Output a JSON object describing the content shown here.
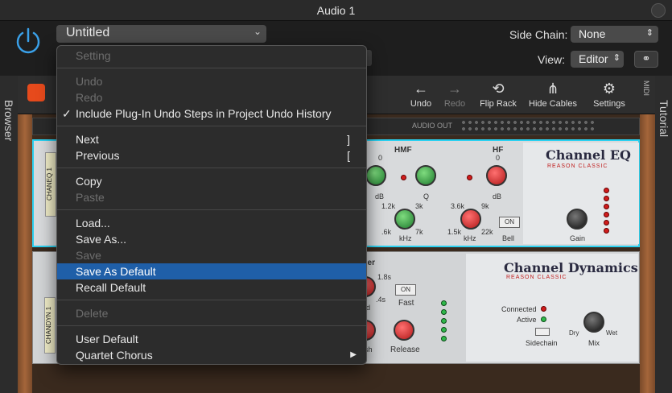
{
  "window": {
    "title": "Audio 1"
  },
  "header": {
    "preset_name": "Untitled",
    "side_chain_label": "Side Chain:",
    "side_chain_value": "None",
    "view_label": "View:",
    "view_value": "Editor"
  },
  "side_tabs": {
    "left": "Browser",
    "right": "Tutorial"
  },
  "toolbar": {
    "undo": "Undo",
    "redo": "Redo",
    "flip_rack": "Flip Rack",
    "hide_cables": "Hide Cables",
    "settings": "Settings",
    "midi": "MIDI"
  },
  "rack": {
    "audio_out": "AUDIO OUT",
    "eq": {
      "strip_label": "CHANEQ 1",
      "brand": "Channel EQ",
      "sub": "REASON CLASSIC",
      "hmf": "HMF",
      "hf": "HF",
      "k_db1": "dB",
      "k_q": "Q",
      "k_khz1": "kHz",
      "k_db2": "dB",
      "k_khz2": "kHz",
      "bell": "Bell",
      "on": "ON",
      "gain": "Gain",
      "t_0a": "0",
      "t_0b": "0",
      "t_12": "1.2k",
      "t_3k": "3k",
      "t_6": ".6k",
      "t_7k": "7k",
      "t_36": "3.6k",
      "t_9k": "9k",
      "t_15": "1.5k",
      "t_22": "22k"
    },
    "dyn": {
      "strip_label": "CHANDYN 1",
      "brand": "Channel Dynamics",
      "sub": "REASON CLASSIC",
      "section": "ller",
      "fast": "Fast",
      "on": "ON",
      "release": "Release",
      "t_18": "1.8s",
      "t_4s": ".4s",
      "connected": "Connected",
      "active": "Active",
      "sidechain": "Sidechain",
      "mix": "Mix",
      "dry": "Dry",
      "wet": "Wet",
      "k_d": "d",
      "k_sh": "sh"
    }
  },
  "menu": {
    "setting": "Setting",
    "undo": "Undo",
    "redo": "Redo",
    "include_undo": "Include Plug-In Undo Steps in Project Undo History",
    "checkmark": "✓",
    "next": "Next",
    "next_sc": "]",
    "previous": "Previous",
    "previous_sc": "[",
    "copy": "Copy",
    "paste": "Paste",
    "load": "Load...",
    "save_as": "Save As...",
    "save": "Save",
    "save_as_default": "Save As Default",
    "recall_default": "Recall Default",
    "delete": "Delete",
    "user_default": "User Default",
    "quartet_chorus": "Quartet Chorus",
    "submenu_arrow": "▶"
  }
}
